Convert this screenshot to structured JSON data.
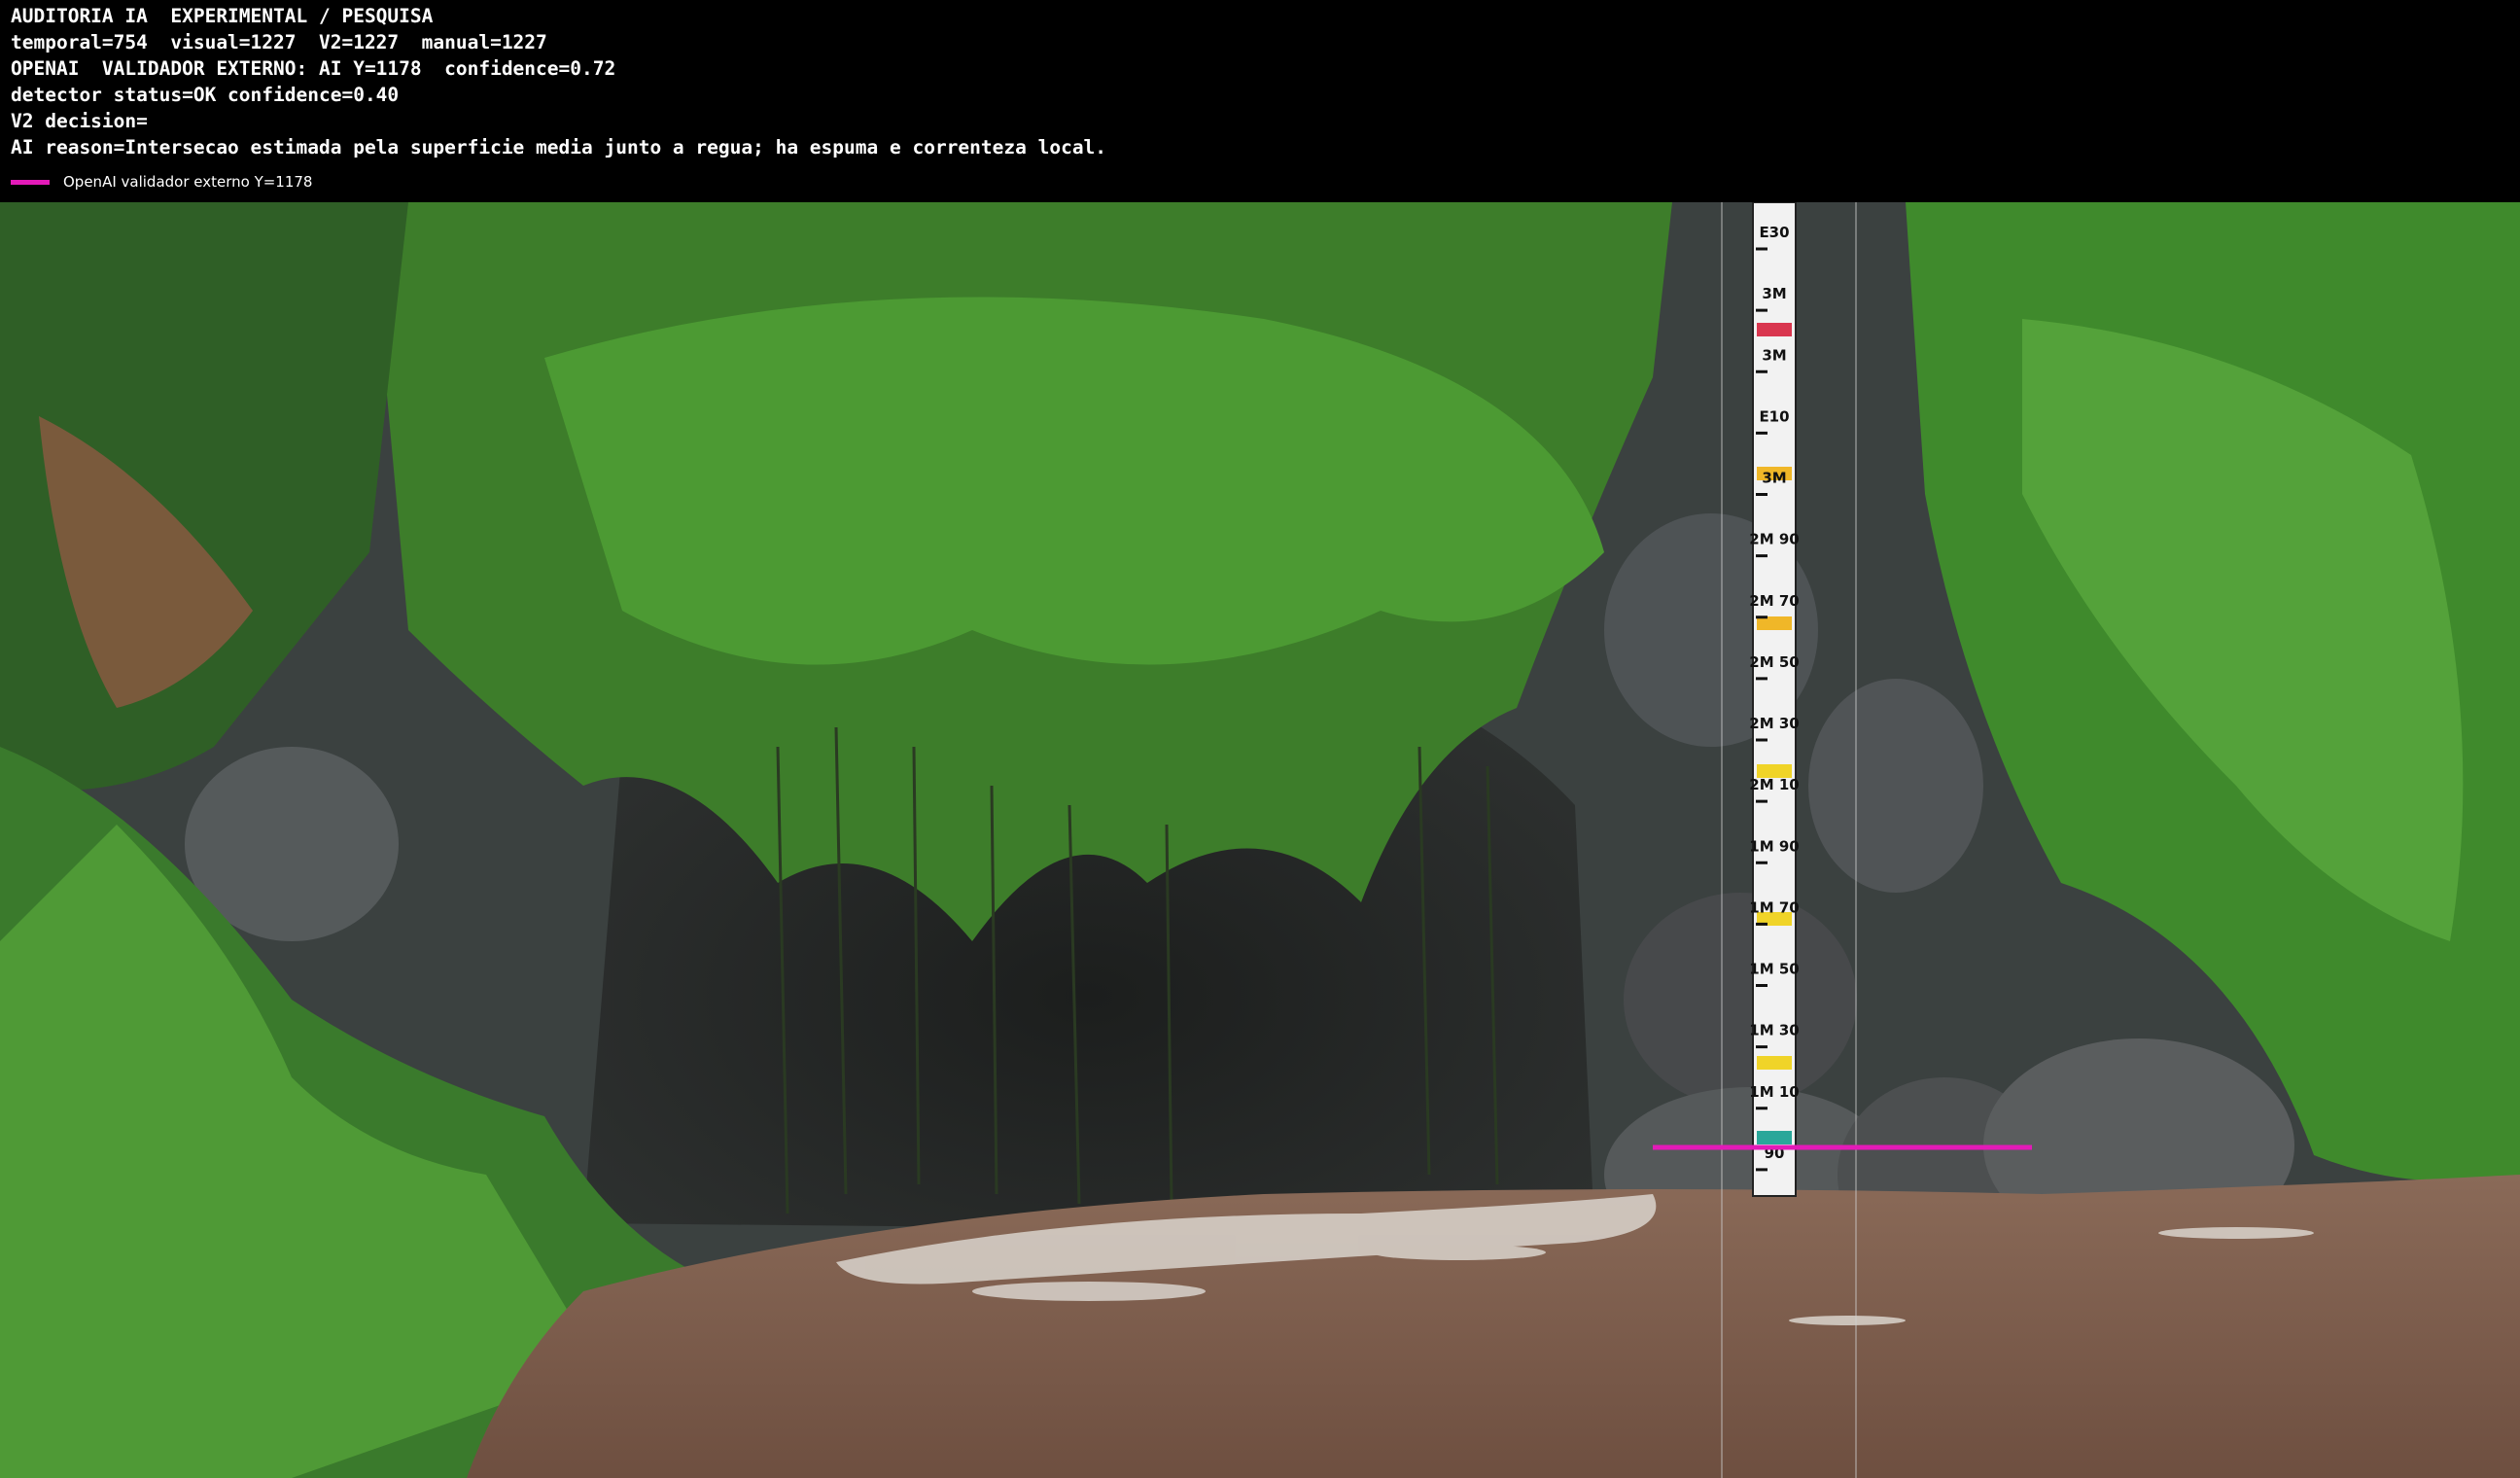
{
  "overlay": {
    "lines": [
      "AUDITORIA IA  EXPERIMENTAL / PESQUISA",
      "temporal=754  visual=1227  V2=1227  manual=1227",
      "OPENAI  VALIDADOR EXTERNO: AI Y=1178  confidence=0.72",
      "detector status=OK confidence=0.40",
      "V2 decision=",
      "AI reason=Intersecao estimada pela superficie media junto a regua; ha espuma e correnteza local."
    ],
    "legend": {
      "label": "OpenAI validador externo Y=1178",
      "color": "#e31ab8"
    }
  },
  "gauge": {
    "labels": [
      "E30",
      "3M",
      "3M",
      "E10",
      "3M",
      "2M 90",
      "2M 70",
      "2M 50",
      "2M 30",
      "2M 10",
      "1M 90",
      "1M 70",
      "1M 50",
      "1M 30",
      "1M 10",
      "90"
    ]
  },
  "colors": {
    "ai_line": "#e31ab8",
    "water": "#7a5b4a",
    "foliage": "#3f8a2a",
    "rock": "#4a4d4f"
  }
}
